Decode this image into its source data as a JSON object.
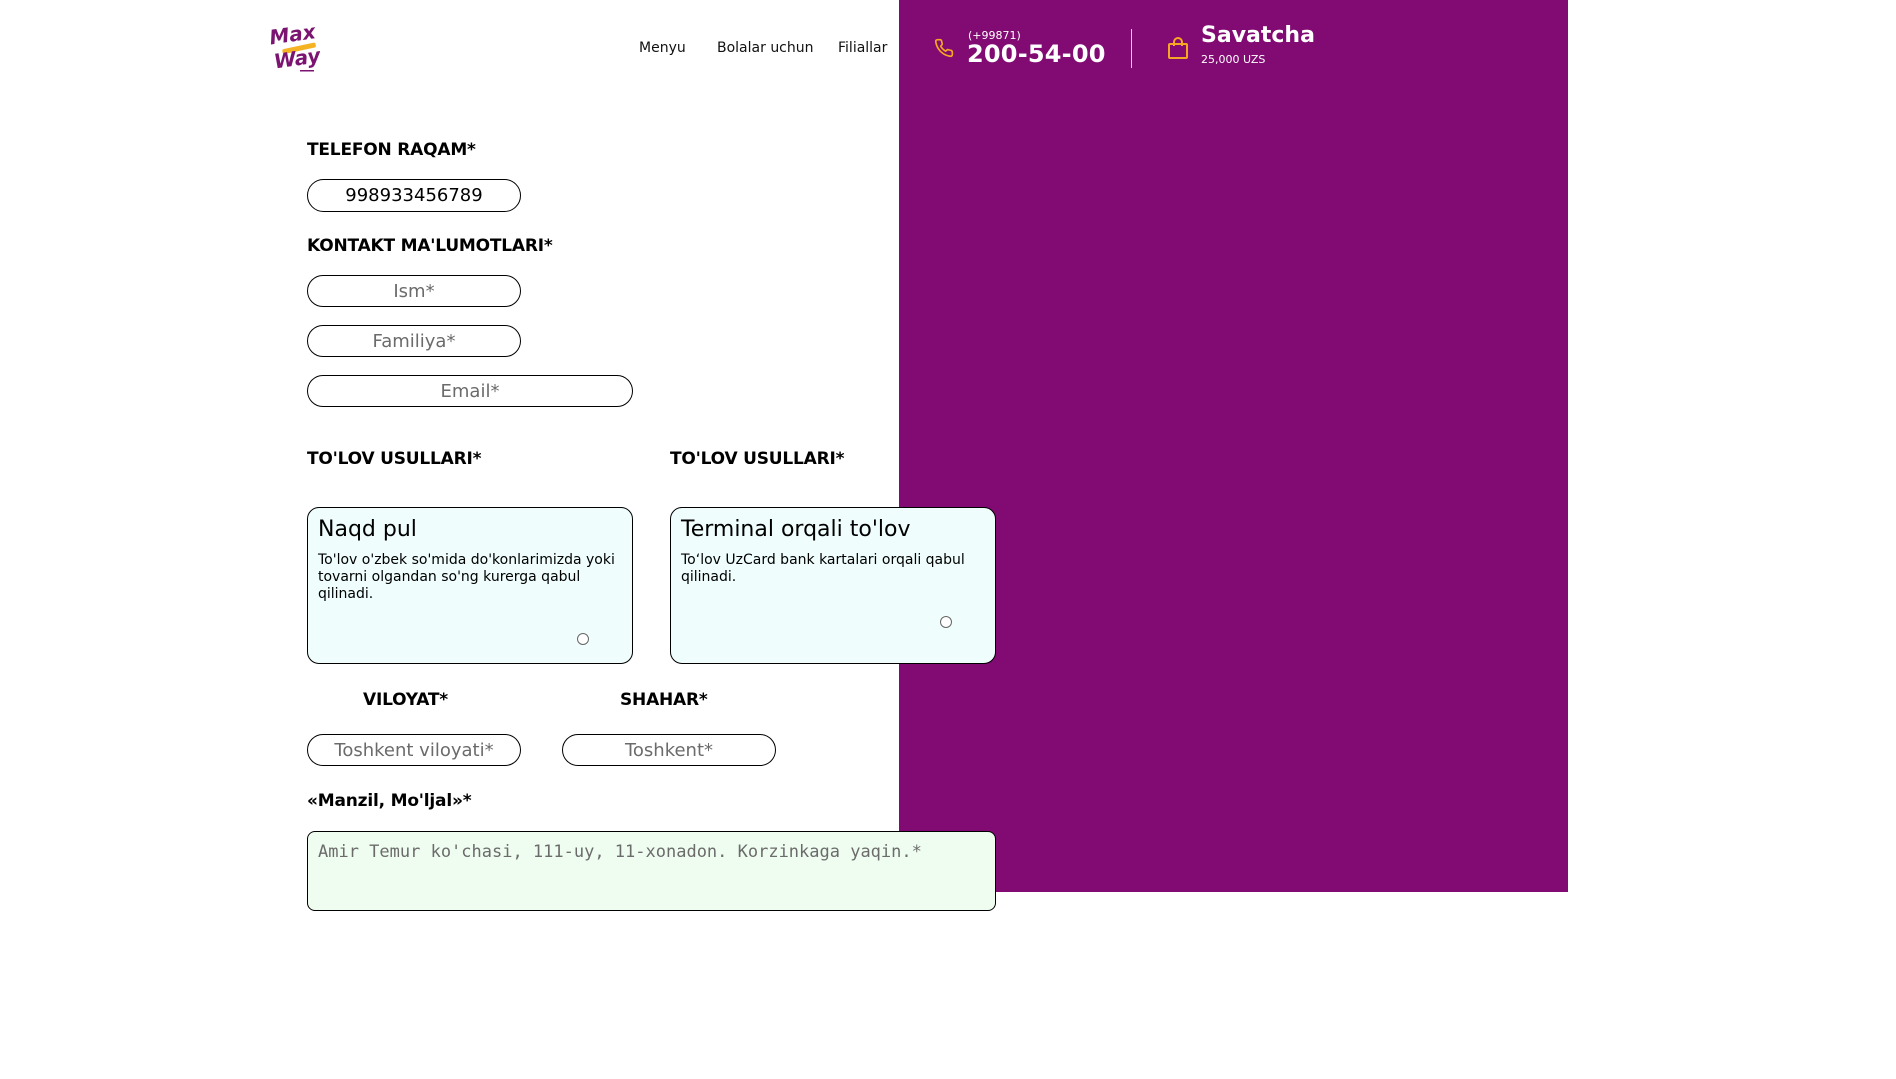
{
  "colors": {
    "accent_purple": "#810b72",
    "icon_orange": "#f5a623",
    "card_bg": "#effdfd",
    "address_bg": "#effdf0"
  },
  "header": {
    "logo_icon": "maxway-logo",
    "nav": [
      {
        "label": "Menyu"
      },
      {
        "label": "Bolalar uchun"
      },
      {
        "label": "Filiallar"
      }
    ],
    "phone": {
      "icon": "phone-icon",
      "code": "(+99871)",
      "number": "200-54-00"
    },
    "cart": {
      "icon": "shopping-bag-icon",
      "title": "Savatcha",
      "total": "25,000 UZS"
    }
  },
  "form": {
    "phone_section": {
      "label": "TELEFON RAQAM*",
      "value": "998933456789"
    },
    "contact_section": {
      "label": "KONTAKT MA'LUMOTLARI*",
      "first_name_placeholder": "Ism*",
      "last_name_placeholder": "Familiya*",
      "email_placeholder": "Email*"
    },
    "payment": {
      "label_left": "TO'LOV USULLARI*",
      "label_right": "TO'LOV USULLARI*",
      "options": [
        {
          "title": "Naqd pul",
          "description": "To'lov o'zbek so'mida do'konlarimizda yoki tovarni olgandan so'ng kurerga qabul qilinadi.",
          "selected": false
        },
        {
          "title": "Terminal orqali to'lov",
          "description": "To‘lov UzCard bank kartalari orqali qabul qilinadi.",
          "selected": false
        }
      ]
    },
    "region": {
      "label": "VILOYAT*",
      "placeholder": "Toshkent viloyati*"
    },
    "city": {
      "label": "SHAHAR*",
      "placeholder": "Toshkent*"
    },
    "address": {
      "label": "«Manzil, Mo'ljal»*",
      "placeholder": "Amir Temur ko'chasi, 111-uy, 11-xonadon. Korzinkaga yaqin.*"
    }
  }
}
